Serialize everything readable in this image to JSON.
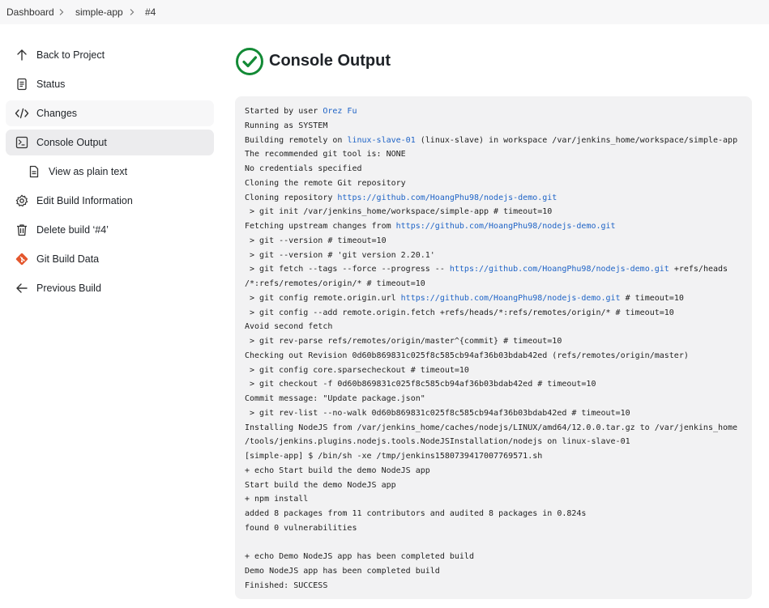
{
  "breadcrumb": {
    "items": [
      "Dashboard",
      "simple-app",
      "#4"
    ]
  },
  "sidebar": {
    "items": [
      {
        "label": "Back to Project",
        "icon": "arrow-up-icon"
      },
      {
        "label": "Status",
        "icon": "document-icon"
      },
      {
        "label": "Changes",
        "icon": "code-icon"
      },
      {
        "label": "Console Output",
        "icon": "terminal-icon",
        "active": true
      },
      {
        "label": "View as plain text",
        "icon": "document-icon"
      },
      {
        "label": "Edit Build Information",
        "icon": "gear-icon"
      },
      {
        "label": "Delete build ‘#4’",
        "icon": "trash-icon"
      },
      {
        "label": "Git Build Data",
        "icon": "git-icon"
      },
      {
        "label": "Previous Build",
        "icon": "arrow-left-icon"
      }
    ]
  },
  "main": {
    "title": "Console Output",
    "status": "success"
  },
  "console": {
    "lines": [
      [
        {
          "t": "Started by user "
        },
        {
          "t": "Orez Fu",
          "link": true
        }
      ],
      [
        {
          "t": "Running as SYSTEM"
        }
      ],
      [
        {
          "t": "Building remotely on "
        },
        {
          "t": "linux-slave-01",
          "link": true
        },
        {
          "t": " (linux-slave) in workspace /var/jenkins_home/workspace/simple-app"
        }
      ],
      [
        {
          "t": "The recommended git tool is: NONE"
        }
      ],
      [
        {
          "t": "No credentials specified"
        }
      ],
      [
        {
          "t": "Cloning the remote Git repository"
        }
      ],
      [
        {
          "t": "Cloning repository "
        },
        {
          "t": "https://github.com/HoangPhu98/nodejs-demo.git",
          "link": true
        }
      ],
      [
        {
          "t": " > git init /var/jenkins_home/workspace/simple-app # timeout=10"
        }
      ],
      [
        {
          "t": "Fetching upstream changes from "
        },
        {
          "t": "https://github.com/HoangPhu98/nodejs-demo.git",
          "link": true
        }
      ],
      [
        {
          "t": " > git --version # timeout=10"
        }
      ],
      [
        {
          "t": " > git --version # 'git version 2.20.1'"
        }
      ],
      [
        {
          "t": " > git fetch --tags --force --progress -- "
        },
        {
          "t": "https://github.com/HoangPhu98/nodejs-demo.git",
          "link": true
        },
        {
          "t": " +refs/heads"
        }
      ],
      [
        {
          "t": "/*:refs/remotes/origin/* # timeout=10"
        }
      ],
      [
        {
          "t": " > git config remote.origin.url "
        },
        {
          "t": "https://github.com/HoangPhu98/nodejs-demo.git",
          "link": true
        },
        {
          "t": " # timeout=10"
        }
      ],
      [
        {
          "t": " > git config --add remote.origin.fetch +refs/heads/*:refs/remotes/origin/* # timeout=10"
        }
      ],
      [
        {
          "t": "Avoid second fetch"
        }
      ],
      [
        {
          "t": " > git rev-parse refs/remotes/origin/master^{commit} # timeout=10"
        }
      ],
      [
        {
          "t": "Checking out Revision 0d60b869831c025f8c585cb94af36b03bdab42ed (refs/remotes/origin/master)"
        }
      ],
      [
        {
          "t": " > git config core.sparsecheckout # timeout=10"
        }
      ],
      [
        {
          "t": " > git checkout -f 0d60b869831c025f8c585cb94af36b03bdab42ed # timeout=10"
        }
      ],
      [
        {
          "t": "Commit message: \"Update package.json\""
        }
      ],
      [
        {
          "t": " > git rev-list --no-walk 0d60b869831c025f8c585cb94af36b03bdab42ed # timeout=10"
        }
      ],
      [
        {
          "t": "Installing NodeJS from /var/jenkins_home/caches/nodejs/LINUX/amd64/12.0.0.tar.gz to /var/jenkins_home"
        }
      ],
      [
        {
          "t": "/tools/jenkins.plugins.nodejs.tools.NodeJSInstallation/nodejs on linux-slave-01"
        }
      ],
      [
        {
          "t": "[simple-app] $ /bin/sh -xe /tmp/jenkins1580739417007769571.sh"
        }
      ],
      [
        {
          "t": "+ echo Start build the demo NodeJS app"
        }
      ],
      [
        {
          "t": "Start build the demo NodeJS app"
        }
      ],
      [
        {
          "t": "+ npm install"
        }
      ],
      [
        {
          "t": "added 8 packages from 11 contributors and audited 8 packages in 0.824s"
        }
      ],
      [
        {
          "t": "found 0 vulnerabilities"
        }
      ],
      [
        {
          "t": ""
        }
      ],
      [
        {
          "t": "+ echo Demo NodeJS app has been completed build"
        }
      ],
      [
        {
          "t": "Demo NodeJS app has been completed build"
        }
      ],
      [
        {
          "t": "Finished: SUCCESS"
        }
      ]
    ]
  },
  "colors": {
    "link": "#1e63c6",
    "success": "#138a36",
    "git": "#e4572e"
  }
}
